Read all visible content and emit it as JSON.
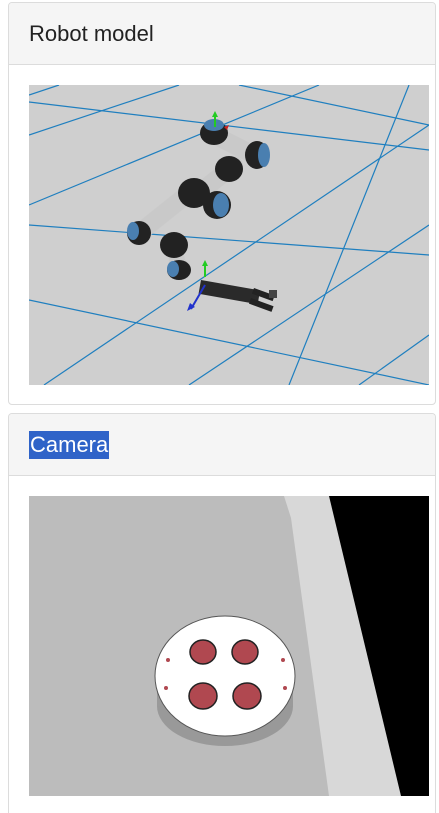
{
  "robot_panel": {
    "title": "Robot model"
  },
  "camera_panel": {
    "title": "Camera",
    "title_selected": true
  },
  "colors": {
    "header_bg": "#f5f5f5",
    "border": "#dcdcdc",
    "grid_floor": "#cfcfcf",
    "grid_lines": "#1f7fbf",
    "robot_link": "#c9c9c9",
    "robot_joint": "#222222",
    "robot_cap": "#4a7fb0",
    "camera_floor": "#bcbcbc",
    "camera_wall": "#d8d8d8",
    "plate": "#ffffff",
    "holes": "#b04850",
    "selection": "#2f63c8"
  }
}
